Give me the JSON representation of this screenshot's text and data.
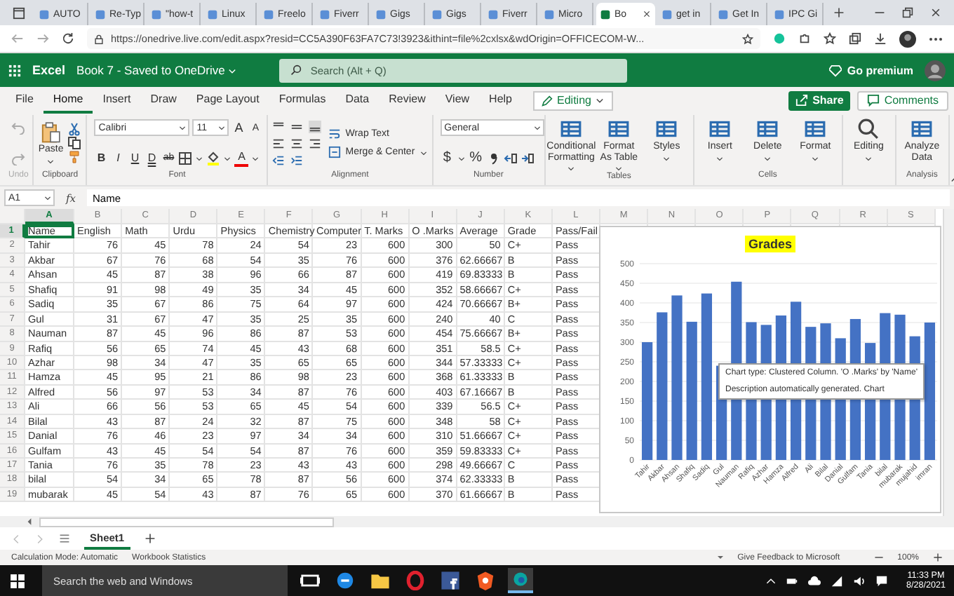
{
  "browser": {
    "tabs": [
      {
        "label": "AUTO",
        "selected": false
      },
      {
        "label": "Re-Typ",
        "selected": false
      },
      {
        "label": "\"how-t",
        "selected": false
      },
      {
        "label": "Linux",
        "selected": false
      },
      {
        "label": "Freelo",
        "selected": false
      },
      {
        "label": "Fiverr",
        "selected": false
      },
      {
        "label": "Gigs",
        "selected": false
      },
      {
        "label": "Gigs",
        "selected": false
      },
      {
        "label": "Fiverr",
        "selected": false
      },
      {
        "label": "Micro",
        "selected": false
      },
      {
        "label": "Bo",
        "selected": true
      },
      {
        "label": "get in",
        "selected": false
      },
      {
        "label": "Get In",
        "selected": false
      },
      {
        "label": "IPC Gi",
        "selected": false
      }
    ],
    "url": "https://onedrive.live.com/edit.aspx?resid=CC5A390F63FA7C73!3923&ithint=file%2cxlsx&wdOrigin=OFFICECOM-W..."
  },
  "app_bar": {
    "app": "Excel",
    "document": "Book 7 - Saved to OneDrive",
    "search": {
      "placeholder": "Search (Alt + Q)"
    },
    "premium": "Go premium"
  },
  "ribbon_tabs": [
    {
      "label": "File",
      "selected": false
    },
    {
      "label": "Home",
      "selected": true
    },
    {
      "label": "Insert",
      "selected": false
    },
    {
      "label": "Draw",
      "selected": false
    },
    {
      "label": "Page Layout",
      "selected": false
    },
    {
      "label": "Formulas",
      "selected": false
    },
    {
      "label": "Data",
      "selected": false
    },
    {
      "label": "Review",
      "selected": false
    },
    {
      "label": "View",
      "selected": false
    },
    {
      "label": "Help",
      "selected": false
    }
  ],
  "mode": "Editing",
  "share": "Share",
  "comments": "Comments",
  "ribbon": {
    "groups": [
      {
        "kind": "undo",
        "label": "Undo"
      },
      {
        "kind": "clipboard",
        "label": "Clipboard",
        "paste": "Paste"
      },
      {
        "kind": "font",
        "label": "Font",
        "font_name": "Calibri",
        "font_size": "11",
        "size_buttons": [
          {
            "label": "A",
            "kind": "grow"
          },
          {
            "label": "A",
            "kind": "shrink"
          }
        ],
        "format_buttons": [
          {
            "label": "B",
            "kind": "bold"
          },
          {
            "label": "I",
            "kind": "italic"
          },
          {
            "label": "U",
            "kind": "underline"
          },
          {
            "label": "D",
            "kind": "double"
          },
          {
            "label": "ab",
            "kind": "strike"
          }
        ],
        "font_color": "A"
      },
      {
        "kind": "alignment",
        "label": "Alignment",
        "wrap": "Wrap Text",
        "merge": "Merge & Center"
      },
      {
        "kind": "number",
        "label": "Number",
        "format": "General",
        "currency": "$",
        "percent": "%"
      },
      {
        "kind": "buttons",
        "label": "Tables",
        "buttons": [
          "Conditional Formatting",
          "Format As Table",
          "Styles"
        ]
      },
      {
        "kind": "buttons",
        "label": "Cells",
        "buttons": [
          "Insert",
          "Delete",
          "Format"
        ]
      },
      {
        "kind": "buttons",
        "buttons": [
          "Editing"
        ]
      },
      {
        "kind": "buttons",
        "label": "Analysis",
        "buttons": [
          "Analyze Data"
        ]
      }
    ]
  },
  "formula_bar": {
    "name_box": "A1",
    "fx": "fx",
    "value": "Name"
  },
  "sheet": {
    "columns": [
      {
        "label": "A",
        "selected": true,
        "kind": "text"
      },
      {
        "label": "B",
        "selected": false,
        "kind": "number"
      },
      {
        "label": "C",
        "selected": false,
        "kind": "number"
      },
      {
        "label": "D",
        "selected": false,
        "kind": "number"
      },
      {
        "label": "E",
        "selected": false,
        "kind": "number"
      },
      {
        "label": "F",
        "selected": false,
        "kind": "number"
      },
      {
        "label": "G",
        "selected": false,
        "kind": "number"
      },
      {
        "label": "H",
        "selected": false,
        "kind": "number"
      },
      {
        "label": "I",
        "selected": false,
        "kind": "number"
      },
      {
        "label": "J",
        "selected": false,
        "kind": "number"
      },
      {
        "label": "K",
        "selected": false,
        "kind": "text"
      },
      {
        "label": "L",
        "selected": false,
        "kind": "text"
      },
      {
        "label": "M",
        "selected": false,
        "kind": "text"
      },
      {
        "label": "N",
        "selected": false,
        "kind": "text"
      },
      {
        "label": "O",
        "selected": false,
        "kind": "text"
      },
      {
        "label": "P",
        "selected": false,
        "kind": "text"
      },
      {
        "label": "Q",
        "selected": false,
        "kind": "text"
      },
      {
        "label": "R",
        "selected": false,
        "kind": "text"
      },
      {
        "label": "S",
        "selected": false,
        "kind": "text"
      }
    ],
    "rows": [
      {
        "number": "1",
        "selected": true,
        "kind": "header",
        "cells": [
          "Name",
          "English",
          "Math",
          "Urdu",
          "Physics",
          "Chemistry",
          "Computer",
          "T. Marks",
          "O .Marks",
          "Average",
          "Grade",
          "Pass/Fail"
        ]
      },
      {
        "number": "2",
        "selected": false,
        "kind": "data",
        "cells": [
          "Tahir",
          "76",
          "45",
          "78",
          "24",
          "54",
          "23",
          "600",
          "300",
          "50",
          "C+",
          "Pass"
        ]
      },
      {
        "number": "3",
        "selected": false,
        "kind": "data",
        "cells": [
          "Akbar",
          "67",
          "76",
          "68",
          "54",
          "35",
          "76",
          "600",
          "376",
          "62.66667",
          "B",
          "Pass"
        ]
      },
      {
        "number": "4",
        "selected": false,
        "kind": "data",
        "cells": [
          "Ahsan",
          "45",
          "87",
          "38",
          "96",
          "66",
          "87",
          "600",
          "419",
          "69.83333",
          "B",
          "Pass"
        ]
      },
      {
        "number": "5",
        "selected": false,
        "kind": "data",
        "cells": [
          "Shafiq",
          "91",
          "98",
          "49",
          "35",
          "34",
          "45",
          "600",
          "352",
          "58.66667",
          "C+",
          "Pass"
        ]
      },
      {
        "number": "6",
        "selected": false,
        "kind": "data",
        "cells": [
          "Sadiq",
          "35",
          "67",
          "86",
          "75",
          "64",
          "97",
          "600",
          "424",
          "70.66667",
          "B+",
          "Pass"
        ]
      },
      {
        "number": "7",
        "selected": false,
        "kind": "data",
        "cells": [
          "Gul",
          "31",
          "67",
          "47",
          "35",
          "25",
          "35",
          "600",
          "240",
          "40",
          "C",
          "Pass"
        ]
      },
      {
        "number": "8",
        "selected": false,
        "kind": "data",
        "cells": [
          "Nauman",
          "87",
          "45",
          "96",
          "86",
          "87",
          "53",
          "600",
          "454",
          "75.66667",
          "B+",
          "Pass"
        ]
      },
      {
        "number": "9",
        "selected": false,
        "kind": "data",
        "cells": [
          "Rafiq",
          "56",
          "65",
          "74",
          "45",
          "43",
          "68",
          "600",
          "351",
          "58.5",
          "C+",
          "Pass"
        ]
      },
      {
        "number": "10",
        "selected": false,
        "kind": "data",
        "cells": [
          "Azhar",
          "98",
          "34",
          "47",
          "35",
          "65",
          "65",
          "600",
          "344",
          "57.33333",
          "C+",
          "Pass"
        ]
      },
      {
        "number": "11",
        "selected": false,
        "kind": "data",
        "cells": [
          "Hamza",
          "45",
          "95",
          "21",
          "86",
          "98",
          "23",
          "600",
          "368",
          "61.33333",
          "B",
          "Pass"
        ]
      },
      {
        "number": "12",
        "selected": false,
        "kind": "data",
        "cells": [
          "Alfred",
          "56",
          "97",
          "53",
          "34",
          "87",
          "76",
          "600",
          "403",
          "67.16667",
          "B",
          "Pass"
        ]
      },
      {
        "number": "13",
        "selected": false,
        "kind": "data",
        "cells": [
          "Ali",
          "66",
          "56",
          "53",
          "65",
          "45",
          "54",
          "600",
          "339",
          "56.5",
          "C+",
          "Pass"
        ]
      },
      {
        "number": "14",
        "selected": false,
        "kind": "data",
        "cells": [
          "Bilal",
          "43",
          "87",
          "24",
          "32",
          "87",
          "75",
          "600",
          "348",
          "58",
          "C+",
          "Pass"
        ]
      },
      {
        "number": "15",
        "selected": false,
        "kind": "data",
        "cells": [
          "Danial",
          "76",
          "46",
          "23",
          "97",
          "34",
          "34",
          "600",
          "310",
          "51.66667",
          "C+",
          "Pass"
        ]
      },
      {
        "number": "16",
        "selected": false,
        "kind": "data",
        "cells": [
          "Gulfam",
          "43",
          "45",
          "54",
          "54",
          "87",
          "76",
          "600",
          "359",
          "59.83333",
          "C+",
          "Pass"
        ]
      },
      {
        "number": "17",
        "selected": false,
        "kind": "data",
        "cells": [
          "Tania",
          "76",
          "35",
          "78",
          "23",
          "43",
          "43",
          "600",
          "298",
          "49.66667",
          "C",
          "Pass"
        ]
      },
      {
        "number": "18",
        "selected": false,
        "kind": "data",
        "cells": [
          "bilal",
          "54",
          "34",
          "65",
          "78",
          "87",
          "56",
          "600",
          "374",
          "62.33333",
          "B",
          "Pass"
        ]
      },
      {
        "number": "19",
        "selected": false,
        "kind": "data",
        "cells": [
          "mubarak",
          "45",
          "54",
          "43",
          "87",
          "76",
          "65",
          "600",
          "370",
          "61.66667",
          "B",
          "Pass"
        ]
      }
    ]
  },
  "chart": {
    "chart_data": {
      "type": "bar",
      "title": "Grades",
      "categories": [
        "Tahir",
        "Akbar",
        "Ahsan",
        "Shafiq",
        "Sadiq",
        "Gul",
        "Nauman",
        "Rafiq",
        "Azhar",
        "Hamza",
        "Alfred",
        "Ali",
        "Bilal",
        "Danial",
        "Gulfam",
        "Tania",
        "bilal",
        "mubarak",
        "mujahid",
        "imran"
      ],
      "series": [
        {
          "color": "#4472c4",
          "values": [
            300,
            376,
            419,
            352,
            424,
            240,
            454,
            351,
            344,
            368,
            403,
            339,
            348,
            310,
            359,
            298,
            374,
            370,
            315,
            350
          ]
        }
      ],
      "grid": true,
      "ylim": [
        0,
        500
      ],
      "yticks": [
        0,
        50,
        100,
        150,
        200,
        250,
        300,
        350,
        400,
        450,
        500
      ]
    },
    "tooltip": [
      "Chart type: Clustered Column. 'O .Marks' by 'Name'",
      "Description automatically generated. Chart"
    ]
  },
  "sheet_tabs": [
    {
      "label": "Sheet1",
      "selected": true
    }
  ],
  "status_bar": {
    "calc_mode": "Calculation Mode: Automatic",
    "statistics": "Workbook Statistics",
    "feedback": "Give Feedback to Microsoft",
    "zoom": "100%"
  },
  "taskbar": {
    "search": {
      "placeholder": "Search the web and Windows"
    },
    "time": "11:33 PM",
    "date": "8/28/2021"
  }
}
